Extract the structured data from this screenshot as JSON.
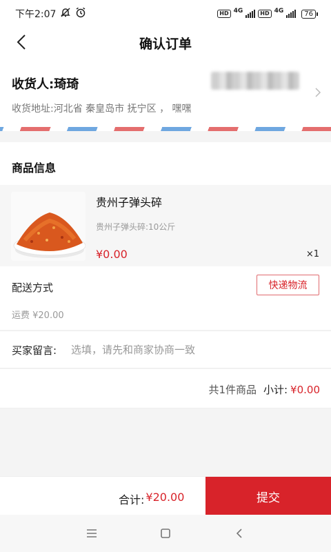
{
  "status_bar": {
    "time": "下午2:07",
    "network1": "4G",
    "network2": "4G",
    "battery": "76",
    "icons": [
      "mute-bell-icon",
      "alarm-icon",
      "hd-icon",
      "signal-icon",
      "battery-icon"
    ]
  },
  "header": {
    "title": "确认订单"
  },
  "address": {
    "recipient": "收货人:琦琦",
    "address_text": "收货地址:河北省 秦皇岛市 抚宁区 ， 嘿嘿"
  },
  "goods": {
    "section_title": "商品信息",
    "product": {
      "name": "贵州子弹头碎",
      "spec": "贵州子弹头碎:10公斤",
      "price": "¥0.00",
      "quantity": "×1"
    }
  },
  "delivery": {
    "label": "配送方式",
    "method": "快递物流",
    "fee": "运费 ¥20.00"
  },
  "message": {
    "label": "买家留言:",
    "placeholder": "选填，请先和商家协商一致"
  },
  "subtotal": {
    "count_text": "共1件商品",
    "label": "小计:",
    "amount": "¥0.00"
  },
  "bottom_bar": {
    "total_label": "合计:",
    "total_amount": "¥20.00",
    "submit_label": "提交"
  },
  "colors": {
    "accent": "#d8232a",
    "background": "#f4f4f4"
  }
}
